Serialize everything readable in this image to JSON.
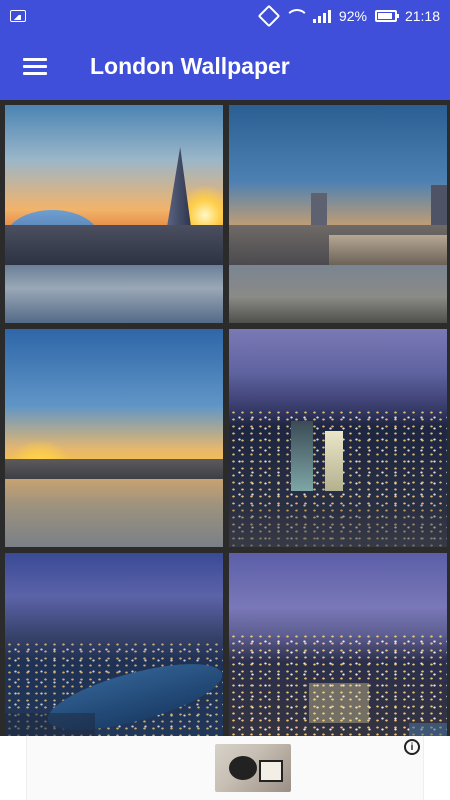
{
  "status_bar": {
    "battery": "92%",
    "time": "21:18",
    "icons": [
      "image-notification-icon",
      "vibrate-icon",
      "wifi-icon",
      "signal-icon",
      "battery-icon"
    ]
  },
  "app_bar": {
    "title": "London Wallpaper",
    "menu_icon": "hamburger-menu-icon",
    "background": "#3f4fd9"
  },
  "gallery": {
    "items": [
      {
        "subject": "the-shard-sunset"
      },
      {
        "subject": "thames-riverside-sunset"
      },
      {
        "subject": "thames-sunset-river"
      },
      {
        "subject": "city-skyline-dusk"
      },
      {
        "subject": "tower-bridge-aerial-dusk"
      },
      {
        "subject": "city-aerial-night"
      }
    ]
  },
  "ad": {
    "info_icon": "i",
    "background": "#ffffff"
  }
}
